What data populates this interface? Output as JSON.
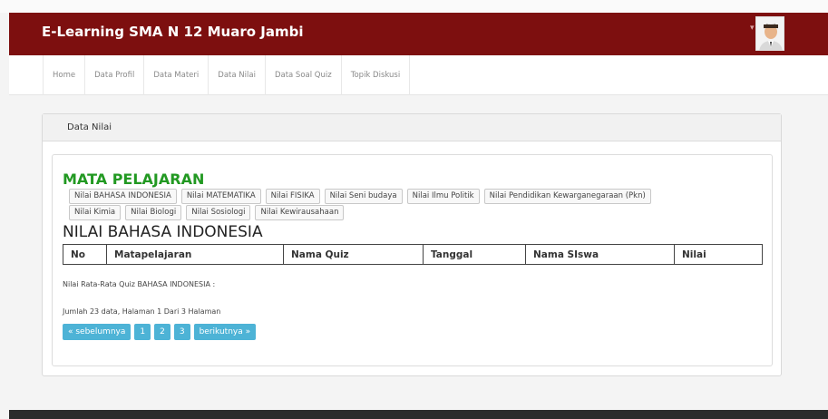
{
  "app": {
    "title": "E-Learning SMA N 12 Muaro Jambi"
  },
  "nav": {
    "items": [
      {
        "label": "Home"
      },
      {
        "label": "Data Profil"
      },
      {
        "label": "Data Materi"
      },
      {
        "label": "Data Nilai"
      },
      {
        "label": "Data Soal Quiz"
      },
      {
        "label": "Topik Diskusi"
      }
    ]
  },
  "panel": {
    "title": "Data Nilai"
  },
  "subjects": {
    "title": "MATA PELAJARAN",
    "row1": [
      {
        "label": "Nilai BAHASA INDONESIA"
      },
      {
        "label": "Nilai MATEMATIKA"
      },
      {
        "label": "Nilai FISIKA"
      },
      {
        "label": "Nilai Seni budaya"
      },
      {
        "label": "Nilai Ilmu Politik"
      },
      {
        "label": "Nilai Pendidikan Kewarganegaraan (Pkn)"
      }
    ],
    "row2": [
      {
        "label": "Nilai Kimia"
      },
      {
        "label": "Nilai Biologi"
      },
      {
        "label": "Nilai Sosiologi"
      },
      {
        "label": "Nilai Kewirausahaan"
      }
    ]
  },
  "grades": {
    "title": "NILAI BAHASA INDONESIA",
    "columns": [
      "No",
      "Matapelajaran",
      "Nama Quiz",
      "Tanggal",
      "Nama SIswa",
      "Nilai"
    ],
    "average_label": "Nilai Rata-Rata Quiz BAHASA INDONESIA :",
    "summary": "Jumlah 23 data, Halaman 1 Dari 3 Halaman"
  },
  "pagination": {
    "prev": "« sebelumnya",
    "pages": [
      "1",
      "2",
      "3"
    ],
    "next": "berikutnya »"
  },
  "colors": {
    "navbar": "#7d0f0f",
    "accent_title": "#229922",
    "pager": "#4db3d6"
  }
}
